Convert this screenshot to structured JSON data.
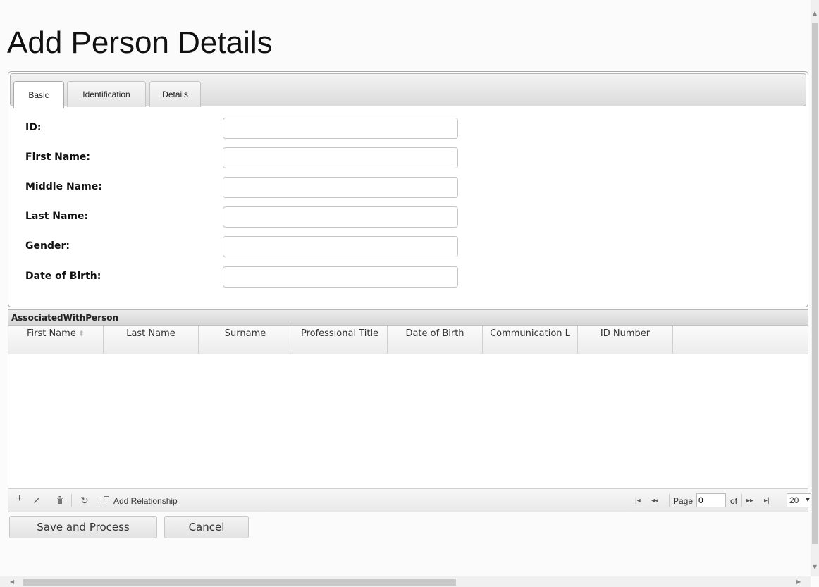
{
  "page": {
    "title": "Add Person Details"
  },
  "tabs": [
    {
      "label": "Basic",
      "active": true
    },
    {
      "label": "Identification",
      "active": false
    },
    {
      "label": "Details",
      "active": false
    }
  ],
  "form": {
    "fields": [
      {
        "label": "ID:",
        "value": ""
      },
      {
        "label": "First Name:",
        "value": ""
      },
      {
        "label": "Middle Name:",
        "value": ""
      },
      {
        "label": "Last Name:",
        "value": ""
      },
      {
        "label": "Gender:",
        "value": ""
      },
      {
        "label": "Date of Birth:",
        "value": ""
      }
    ]
  },
  "grid": {
    "caption": "AssociatedWithPerson",
    "columns": [
      "First Name",
      "Last Name",
      "Surname",
      "Professional Title",
      "Date of Birth",
      "Communication L",
      "ID Number"
    ],
    "rows": [],
    "toolbar": {
      "add_icon": "plus-icon",
      "edit_icon": "pencil-icon",
      "delete_icon": "trash-icon",
      "refresh_icon": "refresh-icon",
      "add_relationship_label": "Add Relationship"
    },
    "pager": {
      "page_label": "Page",
      "page_value": "0",
      "of_label": "of",
      "rows_per_page": "20"
    }
  },
  "buttons": {
    "save": "Save and Process",
    "cancel": "Cancel"
  }
}
